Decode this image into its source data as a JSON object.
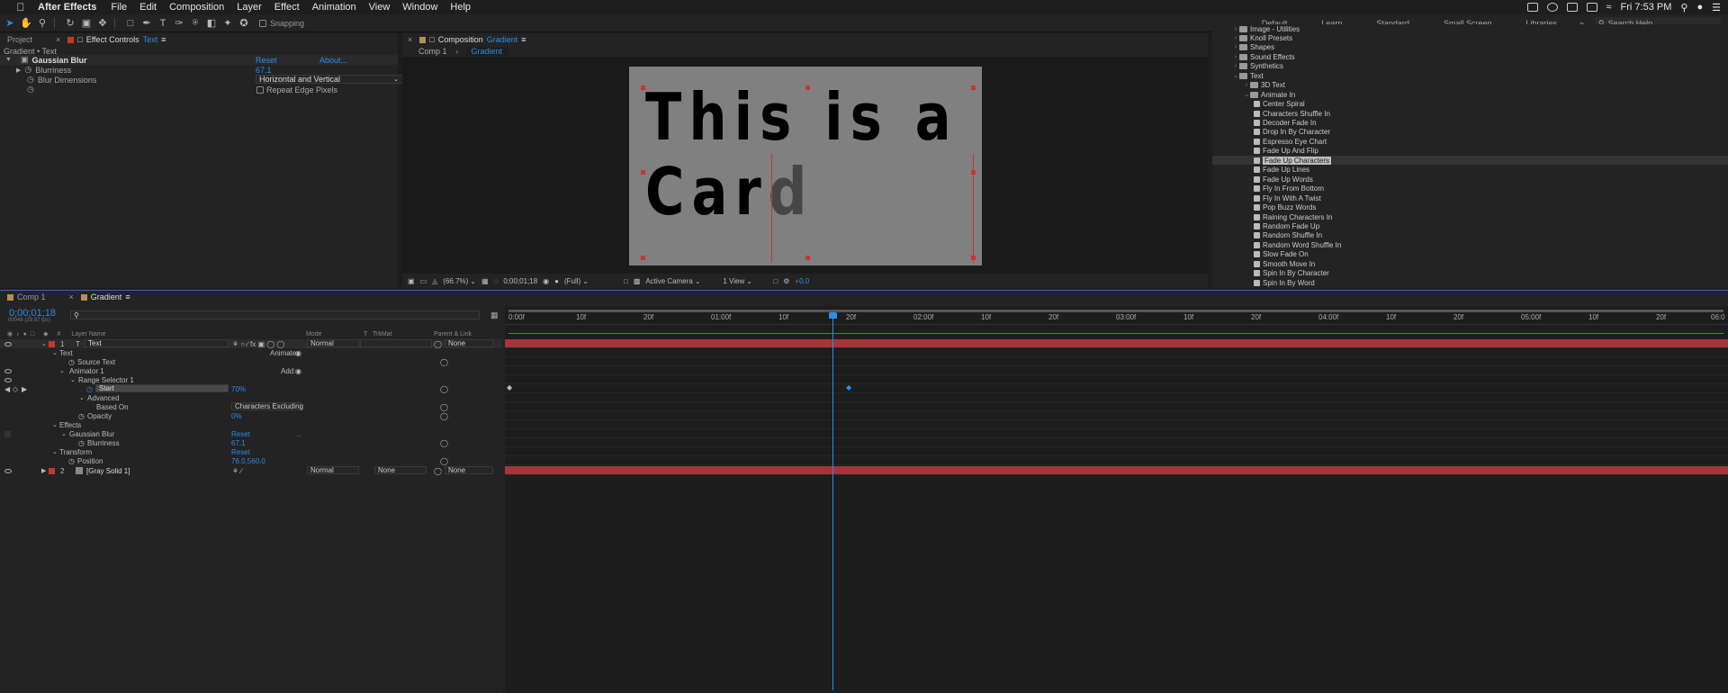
{
  "menubar": {
    "app": "After Effects",
    "items": [
      "File",
      "Edit",
      "Composition",
      "Layer",
      "Effect",
      "Animation",
      "View",
      "Window",
      "Help"
    ],
    "clock": "Fri 7:53 PM"
  },
  "toolbar": {
    "snapping": "Snapping"
  },
  "workspaces": {
    "items": [
      "Default",
      "Learn",
      "Standard",
      "Small Screen",
      "Libraries"
    ],
    "search_placeholder": "Search Help"
  },
  "effect_controls": {
    "tab_project": "Project",
    "tab_label": "Effect Controls",
    "tab_layer": "Text",
    "title": "Gradient • Text",
    "effect_name": "Gaussian Blur",
    "reset": "Reset",
    "about": "About...",
    "blurriness_label": "Blurriness",
    "blurriness_value": "67.1",
    "dimensions_label": "Blur Dimensions",
    "dimensions_value": "Horizontal and Vertical",
    "repeat_edge": "Repeat Edge Pixels"
  },
  "composition": {
    "tab_prefix": "Composition",
    "tab_name": "Gradient",
    "crumb_1": "Comp 1",
    "crumb_2": "Gradient",
    "text_line1": "This is a",
    "text_line2": "Card",
    "viewer": {
      "zoom": "(66.7%)",
      "time": "0;00;01;18",
      "resolution": "(Full)",
      "camera": "Active Camera",
      "views": "1 View",
      "exposure": "+0.0"
    }
  },
  "effects_presets": {
    "items": [
      {
        "label": "Image - Utilities",
        "kind": "folder",
        "level": 0
      },
      {
        "label": "Knoll Presets",
        "kind": "folder",
        "level": 0
      },
      {
        "label": "Shapes",
        "kind": "folder",
        "level": 0
      },
      {
        "label": "Sound Effects",
        "kind": "folder",
        "level": 0
      },
      {
        "label": "Synthetics",
        "kind": "folder",
        "level": 0
      },
      {
        "label": "Text",
        "kind": "folder",
        "level": 0,
        "open": true
      },
      {
        "label": "3D Text",
        "kind": "folder",
        "level": 1
      },
      {
        "label": "Animate In",
        "kind": "folder",
        "level": 1,
        "open": true
      },
      {
        "label": "Center Spiral",
        "kind": "preset",
        "level": 2
      },
      {
        "label": "Characters Shuffle In",
        "kind": "preset",
        "level": 2
      },
      {
        "label": "Decoder Fade In",
        "kind": "preset",
        "level": 2
      },
      {
        "label": "Drop In By Character",
        "kind": "preset",
        "level": 2
      },
      {
        "label": "Espresso Eye Chart",
        "kind": "preset",
        "level": 2
      },
      {
        "label": "Fade Up And Flip",
        "kind": "preset",
        "level": 2
      },
      {
        "label": "Fade Up Characters",
        "kind": "preset",
        "level": 2,
        "selected": true
      },
      {
        "label": "Fade Up Lines",
        "kind": "preset",
        "level": 2
      },
      {
        "label": "Fade Up Words",
        "kind": "preset",
        "level": 2
      },
      {
        "label": "Fly In From Bottom",
        "kind": "preset",
        "level": 2
      },
      {
        "label": "Fly In With A Twist",
        "kind": "preset",
        "level": 2
      },
      {
        "label": "Pop Buzz Words",
        "kind": "preset",
        "level": 2
      },
      {
        "label": "Raining Characters In",
        "kind": "preset",
        "level": 2
      },
      {
        "label": "Random Fade Up",
        "kind": "preset",
        "level": 2
      },
      {
        "label": "Random Shuffle In",
        "kind": "preset",
        "level": 2
      },
      {
        "label": "Random Word Shuffle In",
        "kind": "preset",
        "level": 2
      },
      {
        "label": "Slow Fade On",
        "kind": "preset",
        "level": 2
      },
      {
        "label": "Smooth Move In",
        "kind": "preset",
        "level": 2
      },
      {
        "label": "Spin In By Character",
        "kind": "preset",
        "level": 2
      },
      {
        "label": "Spin In By Word",
        "kind": "preset",
        "level": 2
      }
    ]
  },
  "timeline": {
    "tab_comp1": "Comp 1",
    "tab_gradient": "Gradient",
    "timecode": "0;00;01;18",
    "frames": "00048 (29.97 fps)",
    "headers": {
      "hash": "#",
      "layer_name": "Layer Name",
      "mode": "Mode",
      "t": "T",
      "trkmat": "TrkMat",
      "parent": "Parent & Link"
    },
    "ruler": [
      "0:00f",
      "10f",
      "20f",
      "01:00f",
      "10f",
      "20f",
      "02:00f",
      "10f",
      "20f",
      "03:00f",
      "10f",
      "20f",
      "04:00f",
      "10f",
      "20f",
      "05:00f",
      "10f",
      "20f",
      "06:0"
    ],
    "layer1": {
      "num": "1",
      "name": "Text",
      "mode": "Normal",
      "parent": "None"
    },
    "animate_label": "Animate:",
    "add_label": "Add:",
    "text_group": "Text",
    "source_text": "Source Text",
    "animator": "Animator 1",
    "range_selector": "Range Selector 1",
    "start_label": "Start",
    "start_value": "70%",
    "advanced": "Advanced",
    "based_on_label": "Based On",
    "based_on_value": "Characters Excluding",
    "opacity_label": "Opacity",
    "opacity_value": "0%",
    "effects_group": "Effects",
    "blur_effect": "Gaussian Blur",
    "blur_reset": "Reset",
    "blur_ellipsis": "...",
    "blurriness_label": "Blurriness",
    "blurriness_value": "67.1",
    "transform_group": "Transform",
    "transform_reset": "Reset",
    "position_label": "Position",
    "position_value": "76.0,560.0",
    "layer2": {
      "num": "2",
      "name": "[Gray Solid 1]",
      "mode": "Normal",
      "trkmat": "None",
      "parent": "None"
    },
    "playhead_seconds": 1.6,
    "duration_seconds": 6.0
  },
  "colors": {
    "accent": "#2d8ceb",
    "layer_bar": "#a4353a",
    "handle": "#c8372d",
    "work_area": "#3f8f3c"
  }
}
